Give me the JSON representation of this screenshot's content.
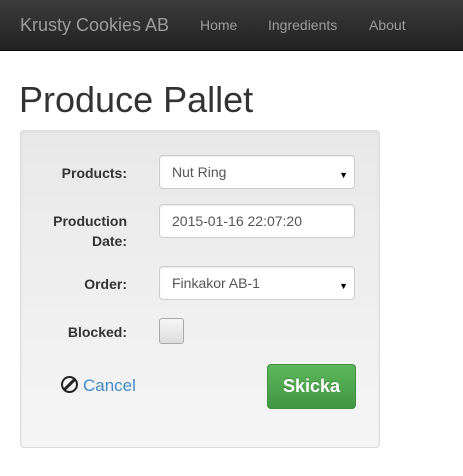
{
  "navbar": {
    "brand": "Krusty Cookies AB",
    "links": [
      "Home",
      "Ingredients",
      "About"
    ]
  },
  "page": {
    "title": "Produce Pallet"
  },
  "form": {
    "products_label": "Products:",
    "products_value": "Nut Ring",
    "date_label": "Production Date:",
    "date_value": "2015-01-16 22:07:20",
    "order_label": "Order:",
    "order_value": "Finkakor AB-1",
    "blocked_label": "Blocked:",
    "blocked_checked": false,
    "cancel_label": "Cancel",
    "submit_label": "Skicka"
  },
  "icons": {
    "cancel": "ban-icon",
    "dropdown": "caret-down-icon"
  },
  "colors": {
    "navbar": "#222222",
    "link": "#428bca",
    "submit": "#5cb85c"
  }
}
